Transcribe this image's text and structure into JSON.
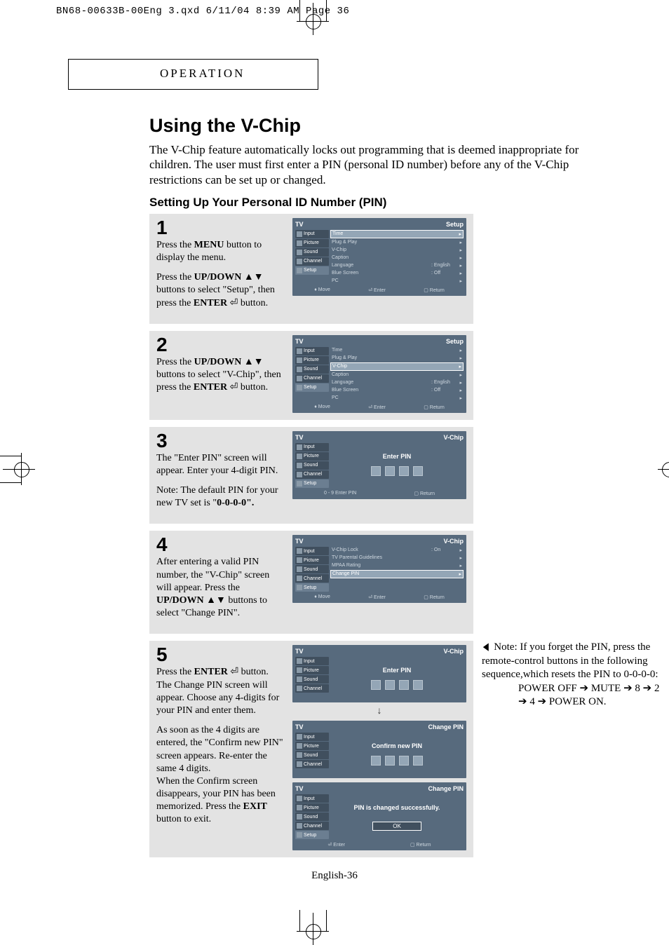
{
  "print_header": "BN68-00633B-00Eng 3.qxd  6/11/04 8:39 AM  Page 36",
  "section_label": "OPERATION",
  "title": "Using the V-Chip",
  "intro": "The V-Chip feature automatically locks out programming that is deemed inappropriate for children. The user must first enter a PIN (personal ID number) before any of the V-Chip restrictions can be set up or changed.",
  "subhead": "Setting Up Your Personal ID Number (PIN)",
  "osd_common": {
    "tv": "TV",
    "tabs": [
      "Input",
      "Picture",
      "Sound",
      "Channel",
      "Setup"
    ],
    "foot_move": "Move",
    "foot_enter": "Enter",
    "foot_return": "Return",
    "foot_pin": "0 - 9 Enter PIN"
  },
  "steps": [
    {
      "num": "1",
      "text_html": "Press the <b>MENU</b> button to display the menu.||Press the <b>UP/DOWN</b> ▲▼ buttons to select \"Setup\", then press the <b>ENTER</b> ⏎ button.",
      "osds": [
        {
          "title": "Setup",
          "highlight": "Time",
          "rows": [
            {
              "lbl": "Time",
              "val": "",
              "arr": "▸"
            },
            {
              "lbl": "Plug & Play",
              "val": "",
              "arr": "▸"
            },
            {
              "lbl": "V-Chip",
              "val": "",
              "arr": "▸"
            },
            {
              "lbl": "Caption",
              "val": "",
              "arr": "▸"
            },
            {
              "lbl": "Language",
              "val": ": English",
              "arr": "▸"
            },
            {
              "lbl": "Blue Screen",
              "val": ": Off",
              "arr": "▸"
            },
            {
              "lbl": "PC",
              "val": "",
              "arr": "▸"
            }
          ],
          "foot": [
            "move",
            "enter",
            "return"
          ]
        }
      ]
    },
    {
      "num": "2",
      "text_html": "Press the <b>UP/DOWN</b> ▲▼ buttons to select \"V-Chip\", then press the <b>ENTER</b> ⏎ button.",
      "osds": [
        {
          "title": "Setup",
          "highlight": "V-Chip",
          "rows": [
            {
              "lbl": "Time",
              "val": "",
              "arr": "▸"
            },
            {
              "lbl": "Plug & Play",
              "val": "",
              "arr": "▸"
            },
            {
              "lbl": "V-Chip",
              "val": "",
              "arr": "▸"
            },
            {
              "lbl": "Caption",
              "val": "",
              "arr": "▸"
            },
            {
              "lbl": "Language",
              "val": ": English",
              "arr": "▸"
            },
            {
              "lbl": "Blue Screen",
              "val": ": Off",
              "arr": "▸"
            },
            {
              "lbl": "PC",
              "val": "",
              "arr": "▸"
            }
          ],
          "foot": [
            "move",
            "enter",
            "return"
          ]
        }
      ]
    },
    {
      "num": "3",
      "text_html": "The \"Enter PIN\" screen will appear. Enter your 4-digit PIN.||Note: The default PIN for your new TV set is \"<b>0-0-0-0\".</b>",
      "osds": [
        {
          "title": "V-Chip",
          "center": "Enter PIN",
          "pinboxes": true,
          "foot": [
            "pin",
            "return"
          ]
        }
      ]
    },
    {
      "num": "4",
      "text_html": "After entering a valid PIN number, the \"V-Chip\" screen will appear. Press the <b>UP/DOWN</b> ▲▼ buttons to select \"Change PIN\".",
      "osds": [
        {
          "title": "V-Chip",
          "highlight": "Change PIN",
          "rows": [
            {
              "lbl": "V-Chip Lock",
              "val": ": On",
              "arr": "▸"
            },
            {
              "lbl": "TV Parental Guidelines",
              "val": "",
              "arr": "▸"
            },
            {
              "lbl": "MPAA Rating",
              "val": "",
              "arr": "▸"
            },
            {
              "lbl": "Change PIN",
              "val": "",
              "arr": "▸"
            }
          ],
          "foot": [
            "move",
            "enter",
            "return"
          ]
        }
      ]
    },
    {
      "num": "5",
      "text_html": "Press the <b>ENTER</b> ⏎ button.|The Change PIN screen will appear. Choose any 4-digits for your PIN and enter them.||As soon as the 4 digits are entered, the \"Confirm new PIN\" screen appears. Re-enter the same 4 digits.|When the Confirm screen disappears, your PIN has been memorized. Press the <b>EXIT</b> button to exit.",
      "osds": [
        {
          "title": "V-Chip",
          "center": "Enter PIN",
          "pinboxes": true,
          "short_tabs": true,
          "foot": []
        },
        {
          "arrow_down": true
        },
        {
          "title": "Change PIN",
          "center": "Confirm new PIN",
          "pinboxes": true,
          "short_tabs": true,
          "foot": []
        },
        {
          "title": "Change PIN",
          "center": "PIN is changed successfully.",
          "ok": "OK",
          "foot": [
            "enter",
            "return"
          ]
        }
      ]
    }
  ],
  "note": {
    "label": "Note:",
    "body": "If you forget the PIN, press the remote-control buttons in the following sequence,which resets the PIN to 0-0-0-0:",
    "seq": "POWER OFF ➔ MUTE ➔ 8 ➔ 2 ➔ 4 ➔ POWER ON."
  },
  "footer": "English-36"
}
